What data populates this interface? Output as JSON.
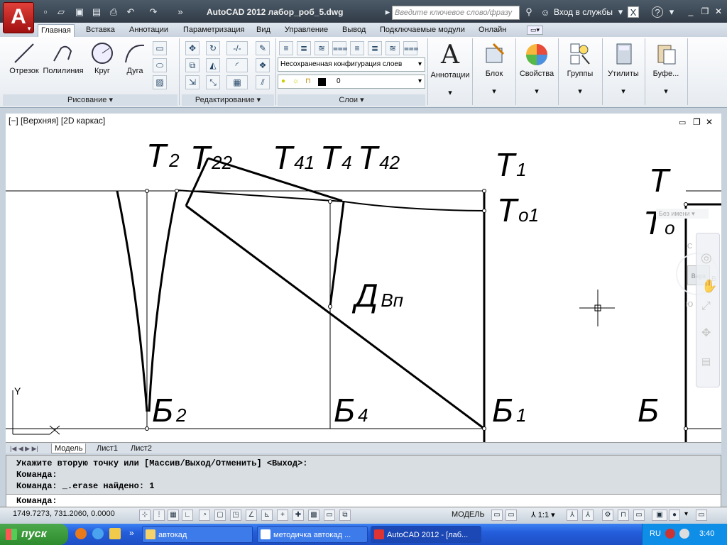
{
  "title": {
    "app": "AutoCAD 2012",
    "file": "лабор_роб_5.dwg",
    "full": "AutoCAD 2012   лабор_роб_5.dwg"
  },
  "search_placeholder": "Введите ключевое слово/фразу",
  "signin": "Вход в службы",
  "tabs": [
    "Главная",
    "Вставка",
    "Аннотации",
    "Параметризация",
    "Вид",
    "Управление",
    "Вывод",
    "Подключаемые модули",
    "Онлайн"
  ],
  "ribbon": {
    "draw": {
      "title": "Рисование",
      "tools": [
        "Отрезок",
        "Полилиния",
        "Круг",
        "Дуга"
      ]
    },
    "modify": {
      "title": "Редактирование"
    },
    "layers": {
      "title": "Слои",
      "layer_state": "Несохраненная конфигурация слоев",
      "current_layer": "0"
    },
    "big": [
      "Аннотации",
      "Блок",
      "Свойства",
      "Группы",
      "Утилиты",
      "Буфе..."
    ]
  },
  "viewport": {
    "label": "[−] [Верхняя] [2D каркас]",
    "viewcube": {
      "top": "Верх",
      "north": "С",
      "east": "В",
      "south": "Ю",
      "ucs": "Без имени"
    },
    "ucs_y": "Y",
    "labels": [
      {
        "main": "Т",
        "sub": "2"
      },
      {
        "main": "Т",
        "sub": "22"
      },
      {
        "main": "Т",
        "sub": "41"
      },
      {
        "main": "Т",
        "sub": "4"
      },
      {
        "main": "Т",
        "sub": "42"
      },
      {
        "main": "Т",
        "sub": "1"
      },
      {
        "main": "Т",
        "sub": "о1"
      },
      {
        "main": "Т",
        "sub": ""
      },
      {
        "main": "Т",
        "sub": "о"
      },
      {
        "main": "Д",
        "sub": "Вп"
      },
      {
        "main": "Б",
        "sub": "2"
      },
      {
        "main": "Б",
        "sub": "4"
      },
      {
        "main": "Б",
        "sub": "1"
      },
      {
        "main": "Б",
        "sub": ""
      }
    ]
  },
  "layout_tabs": [
    "Модель",
    "Лист1",
    "Лист2"
  ],
  "command": {
    "lines": [
      "Укажите вторую точку или [Массив/Выход/Отменить] <Выход>:",
      "Команда:",
      "Команда: _.erase найдено: 1"
    ],
    "prompt": "Команда:"
  },
  "status": {
    "coords": "1749.7273, 731.2060, 0.0000",
    "model": "МОДЕЛЬ",
    "scale": "1:1"
  },
  "taskbar": {
    "start": "пуск",
    "tasks": [
      "автокад",
      "методичка автокад ...",
      "AutoCAD 2012 - [лаб..."
    ],
    "lang": "RU",
    "time": "3:40"
  }
}
